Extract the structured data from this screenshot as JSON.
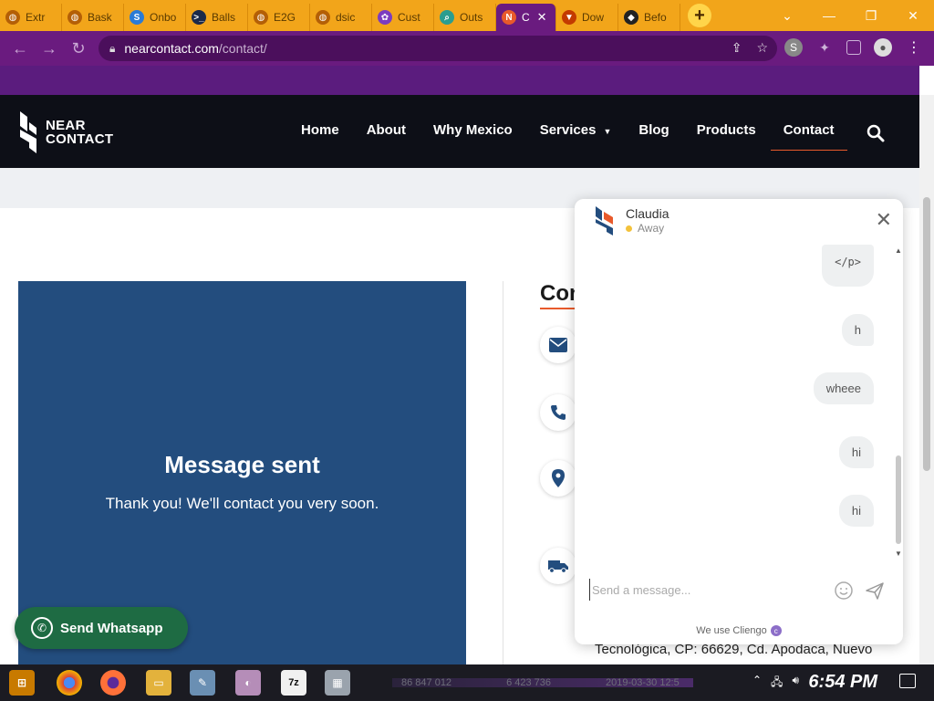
{
  "browser": {
    "tabs": [
      {
        "label": "Extr",
        "icon": "globe-icon",
        "color": "#b45f06"
      },
      {
        "label": "Bask",
        "icon": "globe-icon",
        "color": "#b45f06"
      },
      {
        "label": "Onbo",
        "icon": "s-icon",
        "color": "#2a7bd6"
      },
      {
        "label": "Balls",
        "icon": "terminal-icon",
        "color": "#1b2a4a"
      },
      {
        "label": "E2G",
        "icon": "globe-icon",
        "color": "#b45f06"
      },
      {
        "label": "dsic",
        "icon": "globe-icon",
        "color": "#b45f06"
      },
      {
        "label": "Cust",
        "icon": "flower-icon",
        "color": "#7b3cc0"
      },
      {
        "label": "Outs",
        "icon": "search-icon",
        "color": "#2a9d8f"
      },
      {
        "label": "C",
        "icon": "nearcontact-icon",
        "color": "#e85a2b",
        "active": true
      },
      {
        "label": "Dow",
        "icon": "brave-icon",
        "color": "#c33a00"
      },
      {
        "label": "Befo",
        "icon": "shield-icon",
        "color": "#222"
      }
    ],
    "new_tab": "+",
    "url_host": "nearcontact.com",
    "url_path": "/contact/"
  },
  "site": {
    "logo_line1": "NEAR",
    "logo_line2": "CONTACT",
    "nav": [
      "Home",
      "About",
      "Why Mexico",
      "Services",
      "Blog",
      "Products",
      "Contact"
    ],
    "nav_active": "Contact",
    "accent": "#e85a2b",
    "panel_color": "#234d7e"
  },
  "message": {
    "title": "Message sent",
    "subtitle": "Thank you! We'll contact you very soon."
  },
  "contact": {
    "heading": "Con",
    "address_line": "Tecnológica, CP: 66629, Cd. Apodaca, Nuevo"
  },
  "whatsapp": {
    "label": "Send Whatsapp"
  },
  "chat": {
    "agent_name": "Claudia",
    "agent_status": "Away",
    "messages": [
      "</p>",
      "h",
      "wheee",
      "hi",
      "hi"
    ],
    "input_placeholder": "Send a message...",
    "footer": "We use Cliengo"
  },
  "taskbar": {
    "clock": "6:54 PM",
    "faded": [
      "86 847 012",
      "6 423 736",
      "2019-03-30 12:5"
    ]
  }
}
